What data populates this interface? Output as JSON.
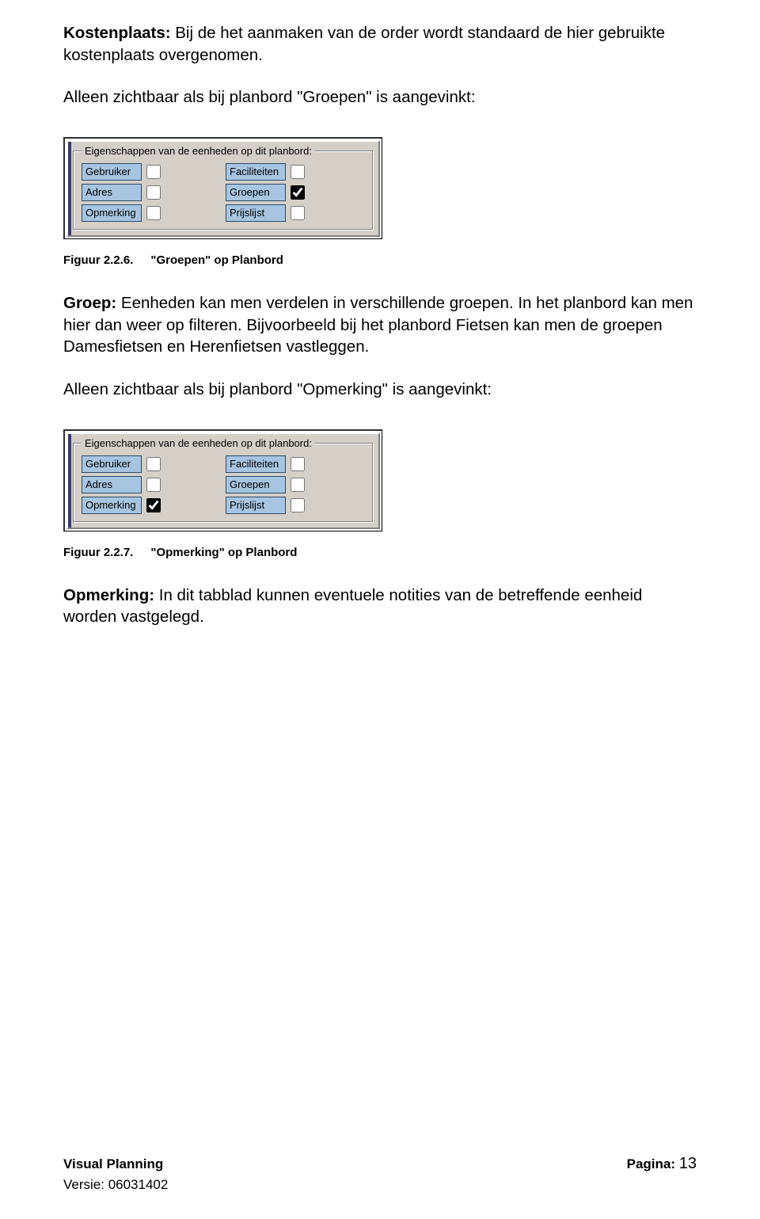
{
  "paragraphs": {
    "kostenplaats_label": "Kostenplaats:",
    "kostenplaats_text": " Bij de het aanmaken van de order wordt standaard de hier gebruikte kostenplaats overgenomen.",
    "intro_groepen": "Alleen zichtbaar als bij planbord \"Groepen\" is aangevinkt:",
    "groep_label": "Groep:",
    "groep_text": " Eenheden kan men verdelen in verschillende groepen. In het planbord kan men hier dan weer op filteren. Bijvoorbeeld bij het planbord Fietsen kan men de groepen Damesfietsen en Herenfietsen vastleggen.",
    "intro_opmerking": "Alleen zichtbaar als bij planbord \"Opmerking\" is aangevinkt:",
    "opmerking_label": "Opmerking:",
    "opmerking_text": " In dit tabblad kunnen eventuele notities van de betreffende eenheid worden vastgelegd."
  },
  "groupbox": {
    "legend": "Eigenschappen van de eenheden op dit planbord:",
    "labels": {
      "gebruiker": "Gebruiker",
      "faciliteiten": "Faciliteiten",
      "adres": "Adres",
      "groepen": "Groepen",
      "opmerking": "Opmerking",
      "prijslijst": "Prijslijst"
    }
  },
  "captions": {
    "fig226_num": "Figuur 2.2.6.",
    "fig226_title": "\"Groepen\" op Planbord",
    "fig227_num": "Figuur 2.2.7.",
    "fig227_title": "\"Opmerking\" op Planbord"
  },
  "footer": {
    "product": "Visual Planning",
    "page_label": "Pagina: ",
    "page_num": "13",
    "versie": "Versie: 06031402"
  },
  "checks": {
    "box1": {
      "gebruiker": false,
      "faciliteiten": false,
      "adres": false,
      "groepen": true,
      "opmerking": false,
      "prijslijst": false
    },
    "box2": {
      "gebruiker": false,
      "faciliteiten": false,
      "adres": false,
      "groepen": false,
      "opmerking": true,
      "prijslijst": false
    }
  }
}
